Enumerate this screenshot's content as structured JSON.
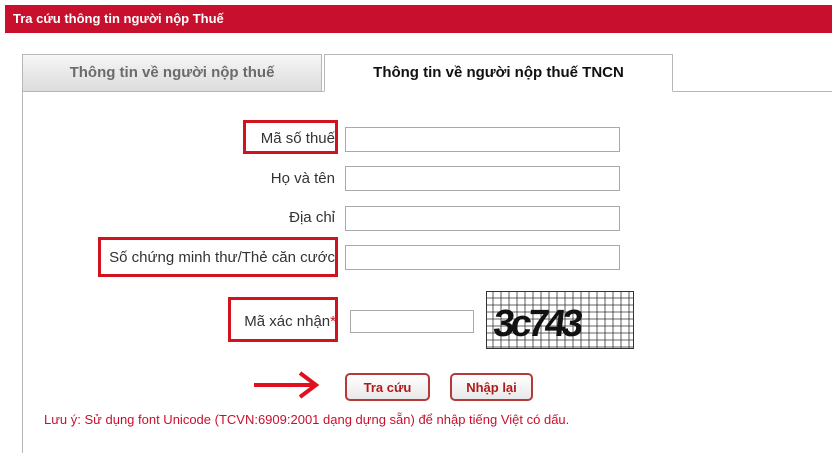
{
  "header": {
    "title": "Tra cứu thông tin người nộp Thuế"
  },
  "tabs": [
    {
      "label": "Thông tin về người nộp thuế",
      "active": false
    },
    {
      "label": "Thông tin về người nộp thuế TNCN",
      "active": true
    }
  ],
  "form": {
    "tax_code": {
      "label": "Mã số thuế",
      "value": ""
    },
    "full_name": {
      "label": "Họ và tên",
      "value": ""
    },
    "address": {
      "label": "Địa chỉ",
      "value": ""
    },
    "id_card": {
      "label": "Số chứng minh thư/Thẻ căn cước",
      "value": ""
    },
    "captcha": {
      "label": "Mã xác nhận",
      "required_mark": "*",
      "value": "",
      "image_text": "3c743"
    }
  },
  "buttons": {
    "search": "Tra cứu",
    "reset": "Nhập lại"
  },
  "note": "Lưu ý: Sử dụng font Unicode (TCVN:6909:2001 dạng dựng sẵn) để nhập tiếng Việt có dấu.",
  "colors": {
    "brand": "#c8102e",
    "highlight": "#d1121f"
  }
}
